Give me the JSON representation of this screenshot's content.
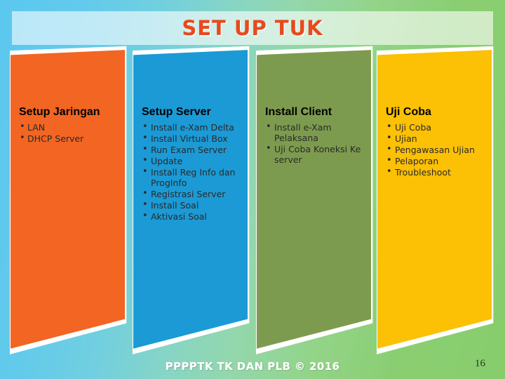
{
  "title": {
    "text": "SET UP TUK",
    "color": "#e8491d"
  },
  "columns": [
    {
      "heading": "Setup Jaringan",
      "color": "#f26522",
      "items": [
        "LAN",
        "DHCP Server"
      ]
    },
    {
      "heading": "Setup Server",
      "color": "#1b9ad6",
      "items": [
        "Install e-Xam Delta",
        "Install Virtual Box",
        "Run Exam Server",
        "Update",
        "Install Reg Info dan ProgInfo",
        "Registrasi Server",
        "Install Soal",
        "Aktivasi Soal"
      ]
    },
    {
      "heading": "Install Client",
      "color": "#7d9b4e",
      "items": [
        "Install e-Xam Pelaksana",
        "Uji Coba Koneksi Ke server"
      ]
    },
    {
      "heading": "Uji Coba",
      "color": "#fcc004",
      "items": [
        "Uji Coba",
        "Ujian",
        "Pengawasan Ujian",
        "Pelaporan",
        "Troubleshoot"
      ]
    }
  ],
  "footer": {
    "text": "PPPPTK TK DAN PLB © 2016",
    "slide_number": "16"
  }
}
